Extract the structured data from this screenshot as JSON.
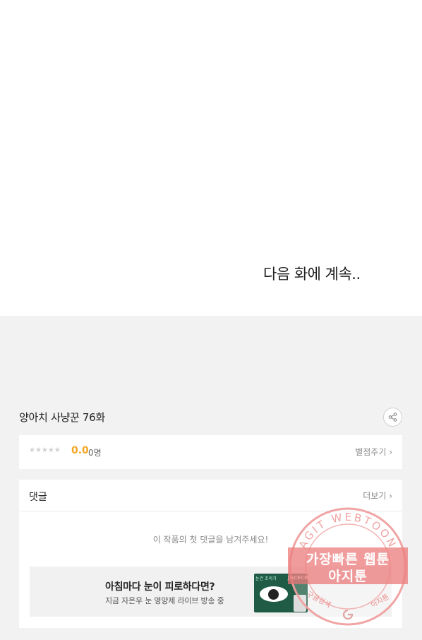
{
  "comic": {
    "continue_text": "다음 화에 계속.."
  },
  "episode": {
    "title": "양아치 사냥꾼 76화",
    "share_icon": "share-icon"
  },
  "rating": {
    "stars": "★★★★★",
    "score": "0.0",
    "count": "0명",
    "rate_link": "별점주기 ›"
  },
  "comments": {
    "title": "댓글",
    "more_link": "더보기 ›",
    "empty_message": "이 작품의 첫 댓글을 남겨주세요!"
  },
  "ad": {
    "title": "아침마다 눈이 피로하다면?",
    "subtitle": "지금 자은우 눈 영양제 라이브 방송 중",
    "brand": "JACECN",
    "label": "눈건 조이기"
  },
  "watermark": {
    "ring_text": "AGIT WEBTOON",
    "line1": "가장빠른 웹툰",
    "line2": "아지툰",
    "bottom_left": "구글검색",
    "bottom_right": "아지툰",
    "accent_color": "#e87878"
  }
}
